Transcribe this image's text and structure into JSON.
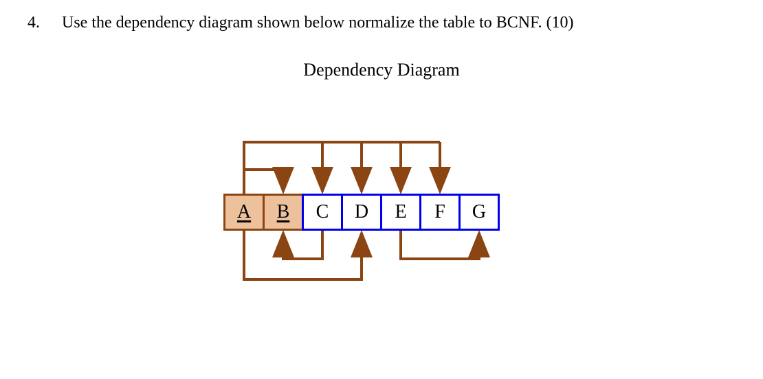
{
  "question": {
    "number": "4.",
    "text": "Use the dependency diagram shown below normalize the table to BCNF. (10)"
  },
  "diagram": {
    "title": "Dependency Diagram",
    "cells": {
      "A": "A",
      "B": "B",
      "C": "C",
      "D": "D",
      "E": "E",
      "F": "F",
      "G": "G"
    }
  }
}
